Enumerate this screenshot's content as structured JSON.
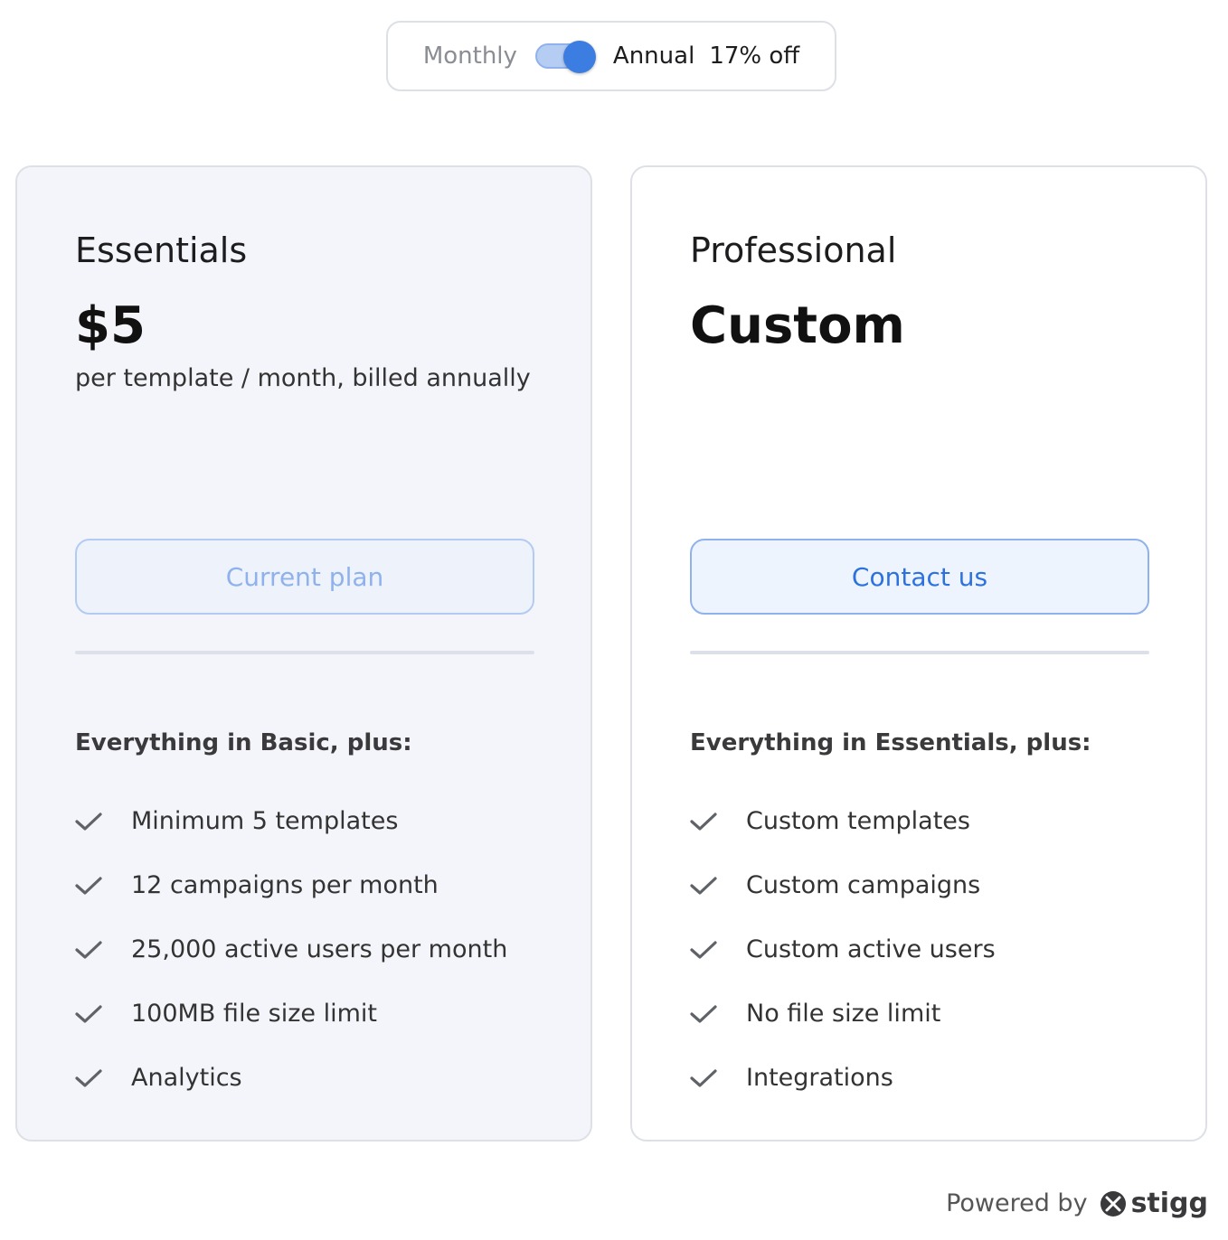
{
  "billing_toggle": {
    "monthly_label": "Monthly",
    "annual_label": "Annual",
    "discount_label": "17% off",
    "selected": "Annual"
  },
  "plans": [
    {
      "name": "Essentials",
      "price": "$5",
      "price_description": "per template / month, billed annually",
      "button_label": "Current plan",
      "features_title": "Everything in Basic, plus:",
      "features": [
        "Minimum 5 templates",
        "12 campaigns per month",
        "25,000 active users per month",
        "100MB file size limit",
        "Analytics"
      ]
    },
    {
      "name": "Professional",
      "price": "Custom",
      "price_description": "",
      "button_label": "Contact us",
      "features_title": "Everything in Essentials, plus:",
      "features": [
        "Custom templates",
        "Custom campaigns",
        "Custom active users",
        "No file size limit",
        "Integrations"
      ]
    }
  ],
  "footer": {
    "powered_by": "Powered by",
    "brand": "stigg"
  },
  "colors": {
    "accent": "#3b7de0",
    "toggle_track": "#b6cdf3",
    "current_card_bg": "#f4f5fa",
    "border": "#dde0e6"
  }
}
